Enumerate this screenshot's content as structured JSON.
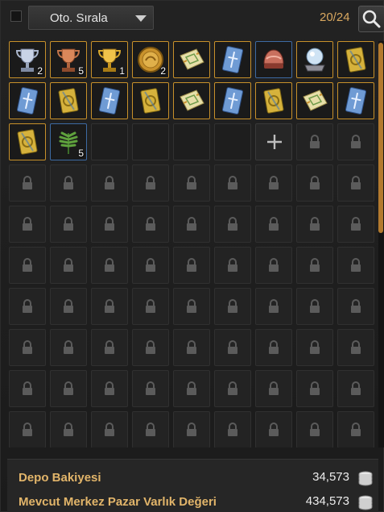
{
  "toolbar": {
    "sort_label": "Oto. Sırala",
    "slot_count": "20/24",
    "search_icon": "search-icon",
    "dropdown_icon": "chevron-down-icon"
  },
  "inventory": {
    "used": 20,
    "capacity": 24,
    "items": [
      {
        "kind": "trophy-silver",
        "qty": "2"
      },
      {
        "kind": "trophy-bronze",
        "qty": "5"
      },
      {
        "kind": "trophy-gold",
        "qty": "1"
      },
      {
        "kind": "gold-coin-medal",
        "qty": "2"
      },
      {
        "kind": "map-scroll",
        "qty": ""
      },
      {
        "kind": "blue-card",
        "qty": ""
      },
      {
        "kind": "red-helmet",
        "qty": ""
      },
      {
        "kind": "crystal-ball",
        "qty": ""
      },
      {
        "kind": "gold-book",
        "qty": ""
      },
      {
        "kind": "blue-card",
        "qty": ""
      },
      {
        "kind": "gold-book",
        "qty": ""
      },
      {
        "kind": "blue-card",
        "qty": ""
      },
      {
        "kind": "gold-book",
        "qty": ""
      },
      {
        "kind": "map-scroll",
        "qty": ""
      },
      {
        "kind": "blue-card",
        "qty": ""
      },
      {
        "kind": "gold-book",
        "qty": ""
      },
      {
        "kind": "map-scroll",
        "qty": ""
      },
      {
        "kind": "blue-card",
        "qty": ""
      },
      {
        "kind": "gold-book",
        "qty": ""
      },
      {
        "kind": "fern-herb",
        "qty": "5"
      }
    ]
  },
  "footer": {
    "balance_label": "Depo Bakiyesi",
    "balance_value": "34,573",
    "market_label": "Mevcut Merkez Pazar Varlık Değeri",
    "market_value": "434,573",
    "currency_icon": "silver-coin-stack-icon"
  },
  "colors": {
    "accent": "#c7902a",
    "label_gold": "#e2b56a",
    "count_text": "#d9a860",
    "scroll_thumb": "#b37a2e"
  }
}
